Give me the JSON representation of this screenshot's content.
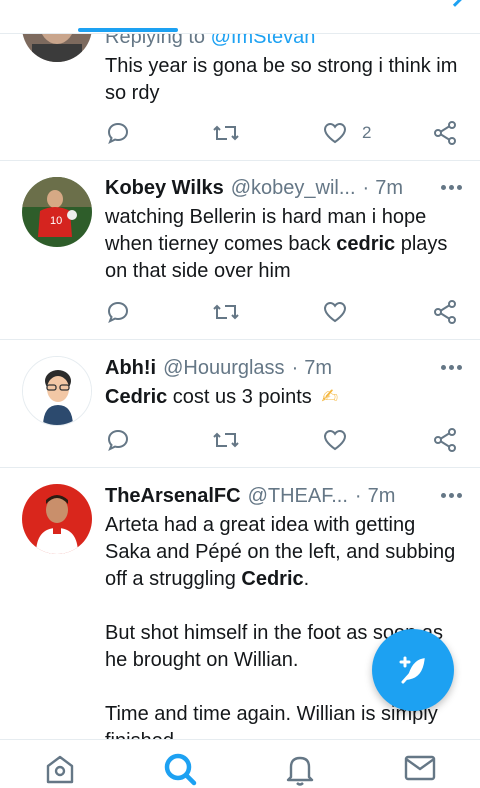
{
  "colors": {
    "accent": "#1da1f2",
    "muted": "#657786",
    "text": "#14171a",
    "divider": "#e6ecf0"
  },
  "tweets": [
    {
      "replying_prefix": "Replying to",
      "replying_handle": "@ImStevan",
      "text": "This year is gona be so strong i think im so rdy",
      "like_count": "2"
    },
    {
      "name": "Kobey Wilks",
      "handle": "@kobey_wil...",
      "dot": "·",
      "time": "7m",
      "text_before": "watching Bellerin is hard man i hope when tierney comes back ",
      "text_bold": "cedric",
      "text_after": " plays on that side over him"
    },
    {
      "name": "Abh!i",
      "handle": "@Houurglass",
      "dot": "·",
      "time": "7m",
      "text_bold": "Cedric",
      "text_after": " cost us 3 points",
      "emoji": "✍"
    },
    {
      "name": "TheArsenalFC",
      "handle": "@THEAF...",
      "dot": "·",
      "time": "7m",
      "para1_before": "Arteta had a great idea with getting Saka and Pépé on the left, and subbing off a struggling ",
      "para1_bold": "Cedric",
      "para1_after": ".",
      "para2": "But shot himself in the foot as soon as he brought on Willian.",
      "para3": "Time and time again. Willian is simply finished."
    }
  ],
  "bottom_nav": {
    "items": [
      {
        "icon": "home-icon"
      },
      {
        "icon": "search-icon"
      },
      {
        "icon": "bell-icon"
      },
      {
        "icon": "mail-icon"
      }
    ]
  },
  "fab": {
    "icon": "compose-feather-icon"
  }
}
